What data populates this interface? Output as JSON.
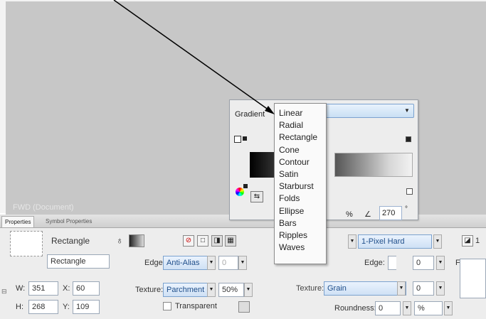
{
  "stage": {
    "label": "FWD (Document)"
  },
  "gradient_panel": {
    "label": "Gradient",
    "select_value": "",
    "angle_value": "270",
    "percent_sign": "%",
    "degree_sign": "°"
  },
  "dropdown": {
    "items": [
      "Linear",
      "Radial",
      "Rectangle",
      "Cone",
      "Contour",
      "Satin",
      "Starburst",
      "Folds",
      "Ellipse",
      "Bars",
      "Ripples",
      "Waves"
    ]
  },
  "tabs": [
    "Properties",
    "Symbol Properties"
  ],
  "properties": {
    "shape_name": "Rectangle",
    "shape_field": "Rectangle",
    "w_label": "W:",
    "w_value": "351",
    "x_label": "X:",
    "x_value": "60",
    "h_label": "H:",
    "h_value": "268",
    "y_label": "Y:",
    "y_value": "109",
    "edge_label": "Edge:",
    "edge_value": "Anti-Alias",
    "edge_num": "0",
    "texture_label": "Texture:",
    "texture_value": "Parchment",
    "texture_pct": "50%",
    "transparent_label": "Transparent",
    "stroke_value": "1-Pixel Hard",
    "stroke_num": "1",
    "stroke_edge_label": "Edge:",
    "stroke_edge_value": "0",
    "stroke_texture_label": "Texture:",
    "stroke_texture_value": "Grain",
    "stroke_texture_num": "0",
    "roundness_label": "Roundness:",
    "roundness_value": "0",
    "roundness_unit": "%",
    "filters_label": "Filters"
  },
  "colors": {
    "accent_field": "#cfe1f5",
    "panel_bg": "#ededed",
    "stage_bg": "#c7c7c7"
  }
}
